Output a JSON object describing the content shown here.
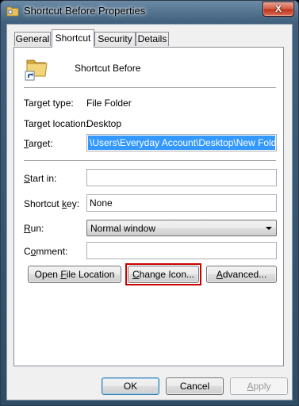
{
  "window": {
    "title": "Shortcut Before Properties",
    "close_glyph": "X"
  },
  "tabs": [
    {
      "label": "General"
    },
    {
      "label": "Shortcut"
    },
    {
      "label": "Security"
    },
    {
      "label": "Details"
    }
  ],
  "shortcut": {
    "name": "Shortcut Before",
    "icon": "folder-shortcut-icon"
  },
  "fields": {
    "target_type_label": "Target type:",
    "target_type_value": "File Folder",
    "target_location_label": "Target location:",
    "target_location_value": "Desktop",
    "target_label_accel": "T",
    "target_label_rest": "arget:",
    "target_value": "\\Users\\Everyday Account\\Desktop\\New Folder\"",
    "start_in_label_accel": "S",
    "start_in_label_rest": "tart in:",
    "start_in_value": "",
    "shortcut_key_label_pre": "Shortcut ",
    "shortcut_key_label_accel": "k",
    "shortcut_key_label_rest": "ey:",
    "shortcut_key_value": "None",
    "run_label_accel": "R",
    "run_label_rest": "un:",
    "run_value": "Normal window",
    "comment_label_pre": "C",
    "comment_label_accel": "o",
    "comment_label_rest": "mment:",
    "comment_value": ""
  },
  "buttons": {
    "open_file_location_pre": "Open ",
    "open_file_location_accel": "F",
    "open_file_location_rest": "ile Location",
    "change_icon_accel": "C",
    "change_icon_rest": "hange Icon...",
    "advanced_accel": "A",
    "advanced_rest": "dvanced...",
    "ok": "OK",
    "cancel": "Cancel",
    "apply_accel": "A",
    "apply_rest": "pply"
  },
  "colors": {
    "selection": "#3399ff",
    "highlight_box": "#cc0000"
  }
}
